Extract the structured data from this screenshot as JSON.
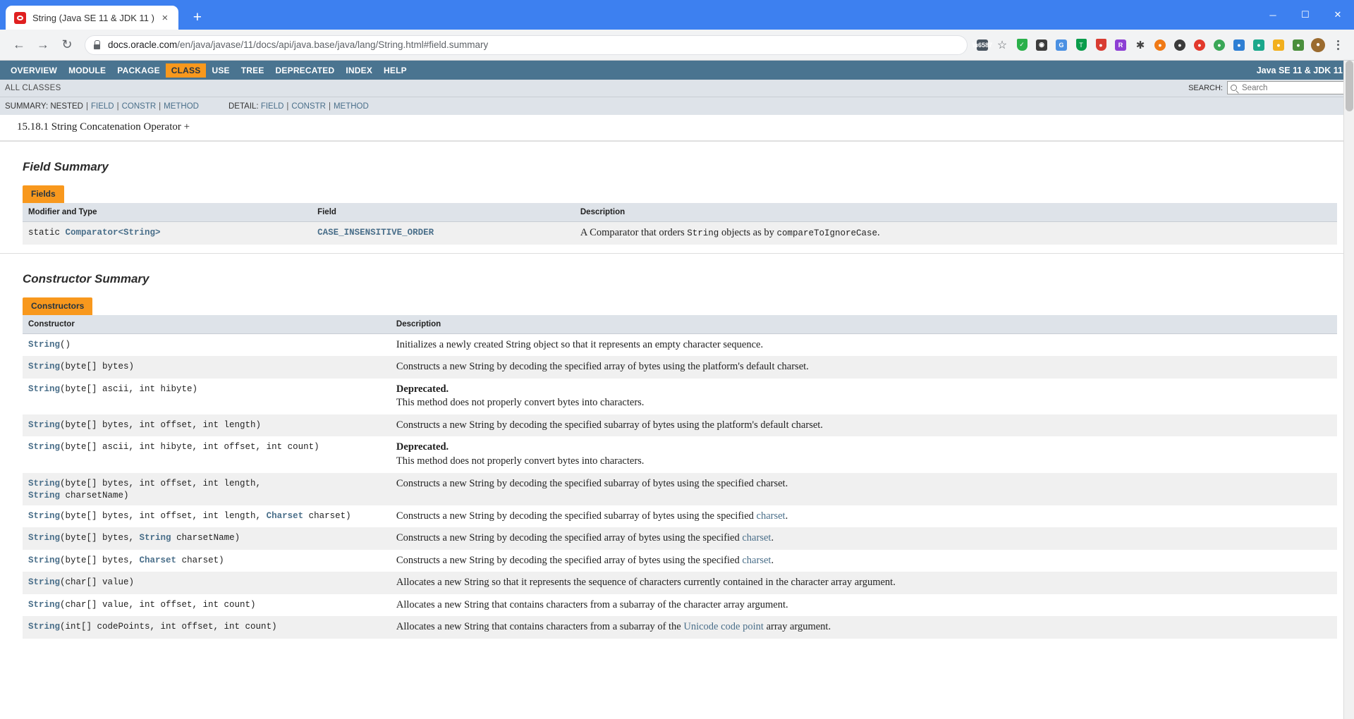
{
  "browser": {
    "tab_title": "String (Java SE 11 & JDK 11 )",
    "new_tab_label": "+",
    "close_tab_label": "×",
    "back_label": "←",
    "forward_label": "→",
    "reload_label": "↻",
    "url_domain": "docs.oracle.com",
    "url_path": "/en/java/javase/11/docs/api/java.base/java/lang/String.html#field.summary",
    "window_minimize": "─",
    "window_maximize": "☐",
    "window_close": "✕",
    "extensions": [
      {
        "name": "translate-icon",
        "glyph": "文",
        "color": "#4a5560"
      },
      {
        "name": "bookmark-star-icon",
        "glyph": "☆",
        "color": "#5f6368"
      },
      {
        "name": "shield-green-icon",
        "glyph": "✓",
        "color": "#2ab04a"
      },
      {
        "name": "ghostery-icon",
        "glyph": "●",
        "color": "#3c3c3c"
      },
      {
        "name": "grammarly-icon",
        "glyph": "G",
        "color": "#4a90e2"
      },
      {
        "name": "tampermonkey-icon",
        "glyph": "T",
        "color": "#0a9c4b"
      },
      {
        "name": "adblock-icon",
        "glyph": "✕",
        "color": "#d83c32"
      },
      {
        "name": "purple-extension-icon",
        "glyph": "R",
        "color": "#8d3fd4"
      },
      {
        "name": "orange-extension-icon",
        "glyph": "●",
        "color": "#f07a16"
      },
      {
        "name": "red-extension-icon",
        "glyph": "●",
        "color": "#cf3a2e"
      },
      {
        "name": "red-circle-extension-icon",
        "glyph": "●",
        "color": "#e2392c"
      },
      {
        "name": "green-extension-icon",
        "glyph": "●",
        "color": "#3aa757"
      },
      {
        "name": "blue-extension-icon",
        "glyph": "●",
        "color": "#2e7fd4"
      },
      {
        "name": "teal-extension-icon",
        "glyph": "●",
        "color": "#1aa88c"
      },
      {
        "name": "yellow-extension-icon",
        "glyph": "●",
        "color": "#f2b01e"
      },
      {
        "name": "multicolor-extension-icon",
        "glyph": "●",
        "color": "#4a8f3c"
      }
    ],
    "avatar_glyph": "●",
    "menu_label": "⋮"
  },
  "javadoc": {
    "topnav": [
      {
        "label": "OVERVIEW",
        "active": false
      },
      {
        "label": "MODULE",
        "active": false
      },
      {
        "label": "PACKAGE",
        "active": false
      },
      {
        "label": "CLASS",
        "active": true
      },
      {
        "label": "USE",
        "active": false
      },
      {
        "label": "TREE",
        "active": false
      },
      {
        "label": "DEPRECATED",
        "active": false
      },
      {
        "label": "INDEX",
        "active": false
      },
      {
        "label": "HELP",
        "active": false
      }
    ],
    "version_label": "Java SE 11 & JDK 11",
    "all_classes_label": "ALL CLASSES",
    "search": {
      "label": "SEARCH:",
      "placeholder": "Search",
      "value": "",
      "clear_label": "✕"
    },
    "summary_bar": {
      "summary_label": "SUMMARY:",
      "summary_items": [
        "NESTED",
        "FIELD",
        "CONSTR",
        "METHOD"
      ],
      "detail_label": "DETAIL:",
      "detail_items": [
        "FIELD",
        "CONSTR",
        "METHOD"
      ],
      "separator": "|"
    },
    "breadcrumb_text": "15.18.1 String Concatenation Operator +",
    "field_summary": {
      "title": "Field Summary",
      "tab_caption": "Fields",
      "headers": [
        "Modifier and Type",
        "Field",
        "Description"
      ],
      "rows": [
        {
          "modifier": "static ",
          "type": "Comparator<String>",
          "field": "CASE_INSENSITIVE_ORDER",
          "desc_pre": "A Comparator that orders ",
          "desc_code1": "String",
          "desc_mid": " objects as by ",
          "desc_code2": "compareToIgnoreCase",
          "desc_post": "."
        }
      ]
    },
    "constructor_summary": {
      "title": "Constructor Summary",
      "tab_caption": "Constructors",
      "headers": [
        "Constructor",
        "Description"
      ],
      "rows": [
        {
          "name": "String",
          "args": "()",
          "deprecated": false,
          "desc": "Initializes a newly created String object so that it represents an empty character sequence.",
          "alt": false
        },
        {
          "name": "String",
          "args": "(byte[] bytes)",
          "deprecated": false,
          "desc": "Constructs a new String by decoding the specified array of bytes using the platform's default charset.",
          "alt": true
        },
        {
          "name": "String",
          "args": "(byte[] ascii, int hibyte)",
          "deprecated": true,
          "deprecated_label": "Deprecated.",
          "desc": "This method does not properly convert bytes into characters.",
          "alt": false
        },
        {
          "name": "String",
          "args": "(byte[] bytes, int offset, int length)",
          "deprecated": false,
          "desc": "Constructs a new String by decoding the specified subarray of bytes using the platform's default charset.",
          "alt": true
        },
        {
          "name": "String",
          "args": "(byte[] ascii, int hibyte, int offset, int count)",
          "deprecated": true,
          "deprecated_label": "Deprecated.",
          "desc": "This method does not properly convert bytes into characters.",
          "alt": false
        },
        {
          "name": "String",
          "args": "(byte[] bytes, int offset, int length,",
          "args_line2_bold": "String",
          "args_line2": " charsetName)",
          "deprecated": false,
          "desc": "Constructs a new String by decoding the specified subarray of bytes using the specified charset.",
          "alt": true
        },
        {
          "name": "String",
          "args": "(byte[] bytes, int offset, int length, ",
          "args_bold": "Charset",
          "args_tail": " charset)",
          "deprecated": false,
          "desc_pre": "Constructs a new String by decoding the specified subarray of bytes using the specified ",
          "desc_link": "charset",
          "desc_post": ".",
          "alt": false
        },
        {
          "name": "String",
          "args": "(byte[] bytes, ",
          "args_bold": "String",
          "args_tail": " charsetName)",
          "deprecated": false,
          "desc_pre": "Constructs a new String by decoding the specified array of bytes using the specified ",
          "desc_link": "charset",
          "desc_post": ".",
          "alt": true
        },
        {
          "name": "String",
          "args": "(byte[] bytes, ",
          "args_bold": "Charset",
          "args_tail": " charset)",
          "deprecated": false,
          "desc_pre": "Constructs a new String by decoding the specified array of bytes using the specified ",
          "desc_link": "charset",
          "desc_post": ".",
          "alt": false
        },
        {
          "name": "String",
          "args": "(char[] value)",
          "deprecated": false,
          "desc": "Allocates a new String so that it represents the sequence of characters currently contained in the character array argument.",
          "alt": true
        },
        {
          "name": "String",
          "args": "(char[] value, int offset, int count)",
          "deprecated": false,
          "desc": "Allocates a new String that contains characters from a subarray of the character array argument.",
          "alt": false
        },
        {
          "name": "String",
          "args": "(int[] codePoints, int offset, int count)",
          "deprecated": false,
          "desc_pre": "Allocates a new String that contains characters from a subarray of the ",
          "desc_link": "Unicode code point",
          "desc_post": " array argument.",
          "alt": true
        }
      ]
    }
  },
  "colors": {
    "accent_orange": "#f8981d",
    "nav_blue": "#4a7490",
    "subnav_gray": "#dee3e9",
    "link_blue": "#4a6f8a",
    "browser_blue": "#3d80f0"
  }
}
